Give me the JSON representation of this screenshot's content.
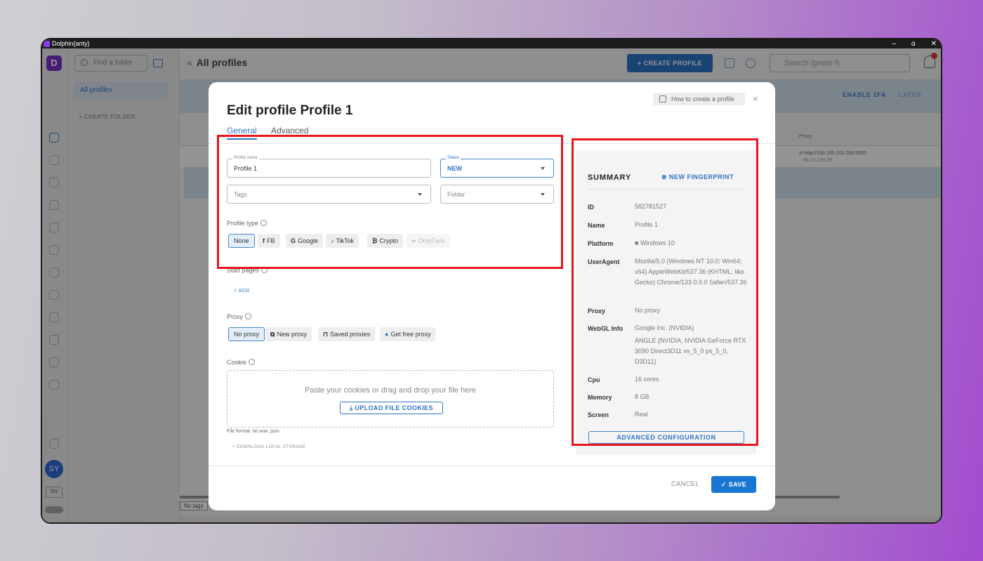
{
  "window": {
    "title": "Dolphin{anty}",
    "controls": [
      "–",
      "ɑ",
      "✕"
    ]
  },
  "folders": {
    "search_placeholder": "Find a folder",
    "all_profiles": "All profiles",
    "create_folder": "+ CREATE FOLDER"
  },
  "toolbar": {
    "breadcrumb_icon": "«",
    "title": "All profiles",
    "create_profile": "+ CREATE PROFILE",
    "search_placeholder": "Search (press /)"
  },
  "banner": {
    "enable_2fa": "ENABLE 2FA",
    "later": "LATER"
  },
  "grid": {
    "proxy_header": "Proxy",
    "row_proxy": "⇄ http://192.155.103.209:9000",
    "row_ip": "90.17.139.29"
  },
  "footer": {
    "no_tags": "No tags"
  },
  "user": {
    "initials": "SY",
    "lang": "EN"
  },
  "modal": {
    "title": "Edit profile Profile 1",
    "howto": "How to create a profile",
    "close": "×",
    "tabs": [
      "General",
      "Advanced"
    ],
    "profile_name_label": "Profile name",
    "profile_name_value": "Profile 1",
    "status_label": "Status",
    "status_value": "NEW",
    "tags_placeholder": "Tags",
    "folder_placeholder": "Folder",
    "profile_type_label": "Profile type",
    "profile_types": [
      {
        "icon": "",
        "label": "None"
      },
      {
        "icon": "f",
        "label": "FB"
      },
      {
        "icon": "G",
        "label": "Google"
      },
      {
        "icon": "♪",
        "label": "TikTok"
      },
      {
        "icon": "₿",
        "label": "Crypto"
      },
      {
        "icon": "∞",
        "label": "OnlyFans"
      }
    ],
    "start_pages_label": "Start pages",
    "add": "+ ADD",
    "proxy_label": "Proxy",
    "proxy_options": [
      {
        "icon": "",
        "label": "No proxy"
      },
      {
        "icon": "⧉",
        "label": "New proxy"
      },
      {
        "icon": "⊓",
        "label": "Saved proxies"
      },
      {
        "icon": "●",
        "label": "Get free proxy"
      }
    ],
    "cookie_label": "Cookie",
    "cookie_hint": "Paste your cookies or drag and drop your file here",
    "upload_button": "⤓ UPLOAD FILE COOKIES",
    "file_format": "File format .txt или .json",
    "download_local_storage": "+ DOWNLOAD LOCAL STORAGE",
    "cancel": "CANCEL",
    "save": "✓ SAVE"
  },
  "summary": {
    "title": "SUMMARY",
    "new_fingerprint": "NEW FINGERPRINT",
    "id_label": "ID",
    "id": "582781527",
    "name_label": "Name",
    "name": "Profile 1",
    "platform_label": "Platform",
    "platform": "Windows 10",
    "useragent_label": "UserAgent",
    "useragent": "Mozilla/5.0 (Windows NT 10.0; Win64; x64) AppleWebKit/537.36 (KHTML, like Gecko) Chrome/133.0.0.0 Safari/537.36",
    "proxy_label": "Proxy",
    "proxy": "No proxy",
    "webgl_label": "WebGL Info",
    "webgl_vendor": "Google Inc. (NVIDIA)",
    "webgl_renderer": "ANGLE (NVIDIA, NVIDIA GeForce RTX 3090 Direct3D11 vs_5_0 ps_5_0, D3D11)",
    "cpu_label": "Cpu",
    "cpu": "16 cores",
    "memory_label": "Memory",
    "memory": "8 GB",
    "screen_label": "Screen",
    "screen": "Real",
    "advanced_config": "ADVANCED CONFIGURATION"
  },
  "colors": {
    "accent": "#2b74c7",
    "highlight": "#e8151b",
    "brand": "#7a32c8"
  }
}
